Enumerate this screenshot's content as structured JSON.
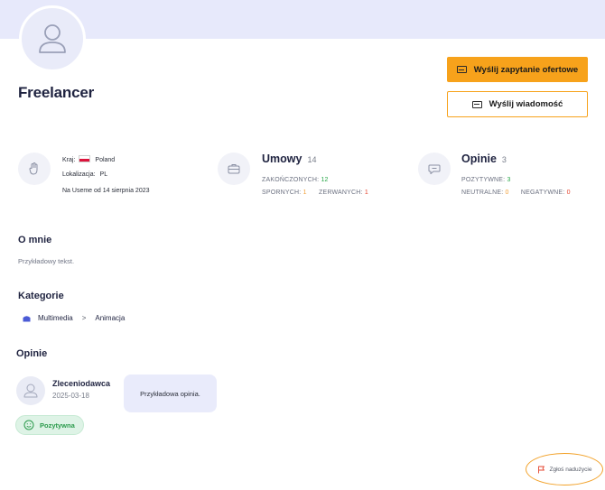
{
  "profile": {
    "name": "Freelancer"
  },
  "actions": {
    "quote_label": "Wyślij zapytanie ofertowe",
    "message_label": "Wyślij wiadomość"
  },
  "info": {
    "country_label": "Kraj:",
    "country_value": "Poland",
    "location_label": "Lokalizacja:",
    "location_value": "PL",
    "member_since": "Na Useme od 14 sierpnia 2023"
  },
  "contracts": {
    "title": "Umowy",
    "count": "14",
    "completed_label": "ZAKOŃCZONYCH:",
    "completed_value": "12",
    "disputed_label": "SPORNYCH:",
    "disputed_value": "1",
    "broken_label": "ZERWANYCH:",
    "broken_value": "1"
  },
  "opinions_stats": {
    "title": "Opinie",
    "count": "3",
    "positive_label": "POZYTYWNE:",
    "positive_value": "3",
    "neutral_label": "NEUTRALNE:",
    "neutral_value": "0",
    "negative_label": "NEGATYWNE:",
    "negative_value": "0"
  },
  "about": {
    "title": "O mnie",
    "text": "Przykładowy tekst."
  },
  "categories": {
    "title": "Kategorie",
    "main": "Multimedia",
    "separator": ">",
    "sub": "Animacja"
  },
  "reviews": {
    "title": "Opinie",
    "items": [
      {
        "author": "Zleceniodawca",
        "date": "2025-03-18",
        "text": "Przykładowa opinia.",
        "badge": "Pozytywna"
      }
    ]
  },
  "report": {
    "label": "Zgłoś nadużycie"
  },
  "colors": {
    "accent": "#f7a21b",
    "header_band": "#e7e9fb",
    "positive": "#2aa84a",
    "neutral": "#f2a03a",
    "negative": "#e5452f"
  }
}
